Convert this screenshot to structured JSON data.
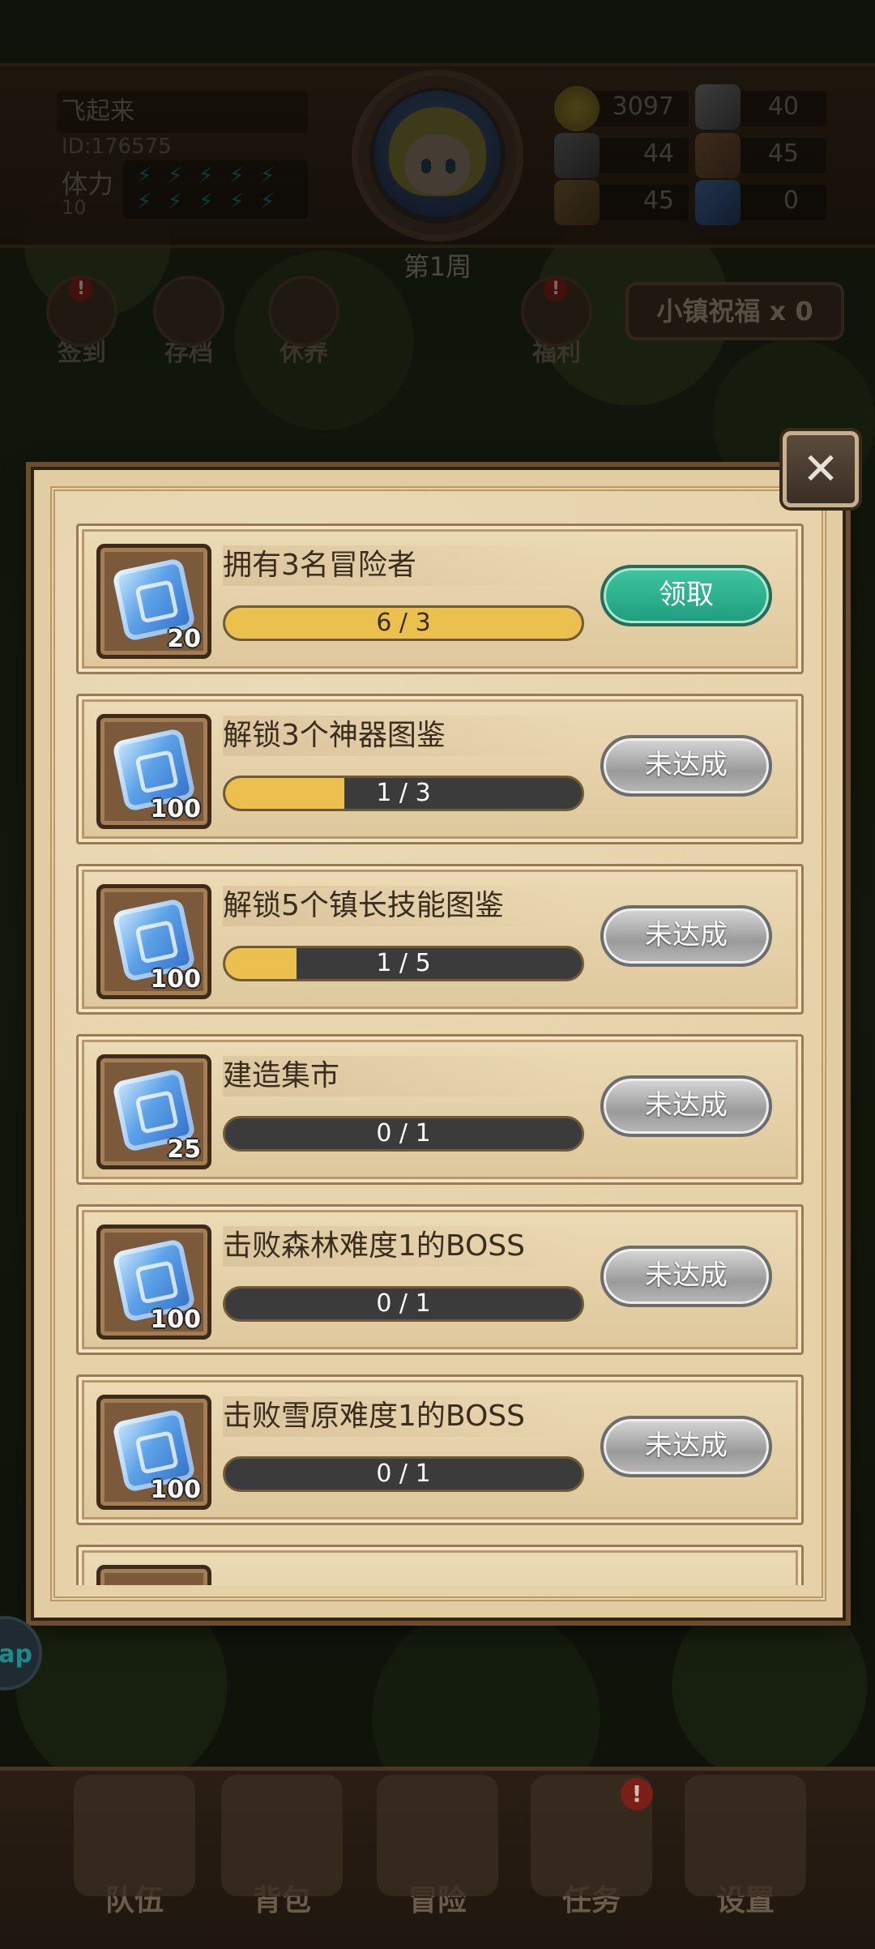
{
  "player": {
    "name": "飞起来",
    "id": "ID:176575",
    "stamina_label": "体力",
    "stamina_value": "10",
    "week": "第1周"
  },
  "resources": [
    {
      "name": "gold",
      "value": "3097"
    },
    {
      "name": "iron",
      "value": "40"
    },
    {
      "name": "stone",
      "value": "44"
    },
    {
      "name": "leather",
      "value": "45"
    },
    {
      "name": "wood",
      "value": "45"
    },
    {
      "name": "crystal",
      "value": "0"
    }
  ],
  "quick_buttons": [
    {
      "label": "签到",
      "alert": "!"
    },
    {
      "label": "存档",
      "alert": ""
    },
    {
      "label": "休养",
      "alert": ""
    },
    {
      "label": "福利",
      "alert": "!"
    }
  ],
  "blessing": "小镇祝福 x 0",
  "tasks": [
    {
      "title": "拥有3名冒险者",
      "reward": "20",
      "progress": 1.0,
      "progress_text": "6 / 3",
      "button": "领取",
      "state": "claim"
    },
    {
      "title": "解锁3个神器图鉴",
      "reward": "100",
      "progress": 0.3333,
      "progress_text": "1 / 3",
      "button": "未达成",
      "state": "locked"
    },
    {
      "title": "解锁5个镇长技能图鉴",
      "reward": "100",
      "progress": 0.2,
      "progress_text": "1 / 5",
      "button": "未达成",
      "state": "locked"
    },
    {
      "title": "建造集市",
      "reward": "25",
      "progress": 0,
      "progress_text": "0 / 1",
      "button": "未达成",
      "state": "locked"
    },
    {
      "title": "击败森林难度1的BOSS",
      "reward": "100",
      "progress": 0,
      "progress_text": "0 / 1",
      "button": "未达成",
      "state": "locked"
    },
    {
      "title": "击败雪原难度1的BOSS",
      "reward": "100",
      "progress": 0,
      "progress_text": "0 / 1",
      "button": "未达成",
      "state": "locked"
    }
  ],
  "side_button": "ap",
  "bottom_nav": [
    {
      "label": "队伍",
      "alert": ""
    },
    {
      "label": "背包",
      "alert": ""
    },
    {
      "label": "冒险",
      "alert": ""
    },
    {
      "label": "任务",
      "alert": "!"
    },
    {
      "label": "设置",
      "alert": ""
    }
  ],
  "colors": {
    "progress_fill": "#ecc04f",
    "claim_button": "#2fb690",
    "locked_button": "#b0b0b0"
  }
}
